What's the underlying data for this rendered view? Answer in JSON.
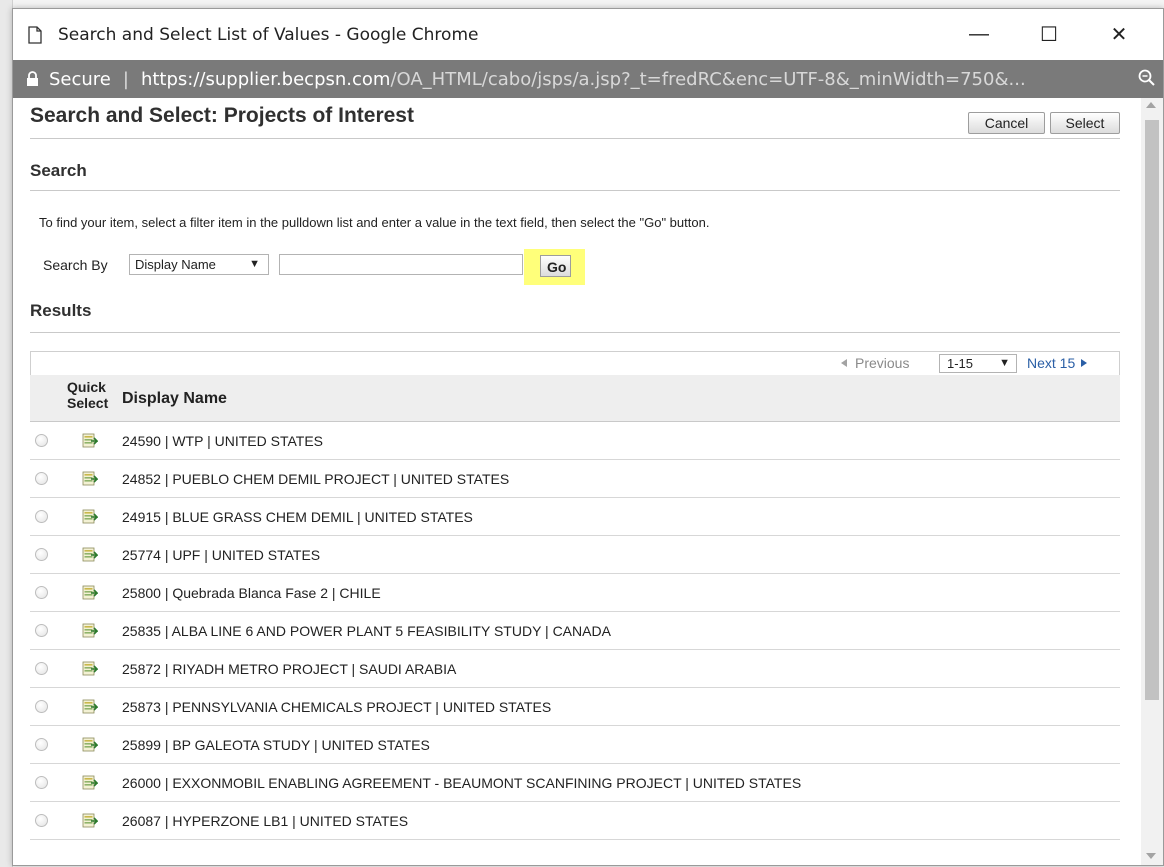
{
  "window": {
    "title": "Search and Select List of Values - Google Chrome",
    "controls": {
      "minimize": "—",
      "maximize": "☐",
      "close": "✕"
    }
  },
  "address": {
    "secure_label": "Secure",
    "separator": "|",
    "url_host": "https://supplier.becpsn.com",
    "url_path": "/OA_HTML/cabo/jsps/a.jsp?_t=fredRC&enc=UTF-8&_minWidth=750&..."
  },
  "page": {
    "title": "Search and Select: Projects of Interest",
    "cancel_label": "Cancel",
    "select_label": "Select"
  },
  "search": {
    "heading": "Search",
    "instructions": "To find your item, select a filter item in the pulldown list and enter a value in the text field, then select the \"Go\" button.",
    "search_by_label": "Search By",
    "filter_value": "Display Name",
    "filter_arrow": "▼",
    "text_value": "",
    "go_label": "Go",
    "go_highlight_color": "#ffff7a"
  },
  "results": {
    "heading": "Results",
    "previous_label": "Previous",
    "range_value": "1-15",
    "range_arrow": "▼",
    "next_label": "Next 15",
    "columns": {
      "quick_select": "Quick Select",
      "display_name": "Display Name"
    },
    "rows": [
      "24590 | WTP | UNITED STATES",
      "24852 | PUEBLO CHEM DEMIL PROJECT | UNITED STATES",
      "24915 | BLUE GRASS CHEM DEMIL | UNITED STATES",
      "25774 | UPF | UNITED STATES",
      "25800 | Quebrada Blanca Fase 2 | CHILE",
      "25835 | ALBA LINE 6 AND POWER PLANT 5 FEASIBILITY STUDY | CANADA",
      "25872 | RIYADH METRO PROJECT | SAUDI ARABIA",
      "25873 | PENNSYLVANIA CHEMICALS PROJECT | UNITED STATES",
      "25899 | BP GALEOTA STUDY | UNITED STATES",
      "26000 | EXXONMOBIL ENABLING AGREEMENT - BEAUMONT SCANFINING PROJECT | UNITED STATES",
      "26087 | HYPERZONE LB1 | UNITED STATES"
    ]
  },
  "colors": {
    "address_bar": "#7a7a7a",
    "link": "#2b5fa6",
    "header_bg": "#eeeeee"
  },
  "icons": {
    "page": "page-icon",
    "lock": "lock-icon",
    "zoom": "zoom-icon",
    "quick_select": "quick-select-icon"
  }
}
